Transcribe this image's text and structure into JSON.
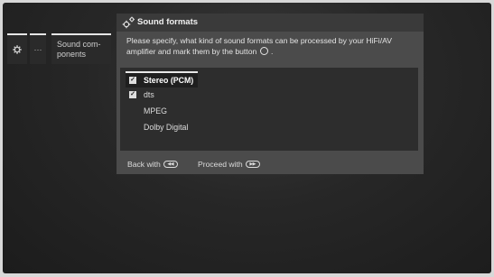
{
  "breadcrumb": {
    "gear_icon": "gear-icon",
    "ellipsis": "···",
    "section_label": "Sound com-ponents",
    "section_label_line1": "Sound com-",
    "section_label_line2": "ponents"
  },
  "dialog": {
    "title_icon": "gear-icon",
    "title": "Sound formats",
    "description_part1": "Please specify, what kind of sound formats can be processed by your HiFi/AV amplifier and mark them by the button",
    "description_end": ".",
    "ok_icon": "ok-button-icon",
    "options": [
      {
        "label": "Stereo (PCM)",
        "checked": true,
        "selected": true
      },
      {
        "label": "dts",
        "checked": true,
        "selected": false
      },
      {
        "label": "MPEG",
        "checked": false,
        "selected": false
      },
      {
        "label": "Dolby Digital",
        "checked": false,
        "selected": false
      }
    ],
    "footer": {
      "back_label": "Back with",
      "back_key_icon": "rewind-key-icon",
      "proceed_label": "Proceed with",
      "proceed_key_icon": "fast-forward-key-icon"
    }
  },
  "colors": {
    "background": "#1c1c1c",
    "dialog_body": "#4b4b4b",
    "list_panel": "#2d2d2d",
    "text": "#e4e4e4"
  }
}
